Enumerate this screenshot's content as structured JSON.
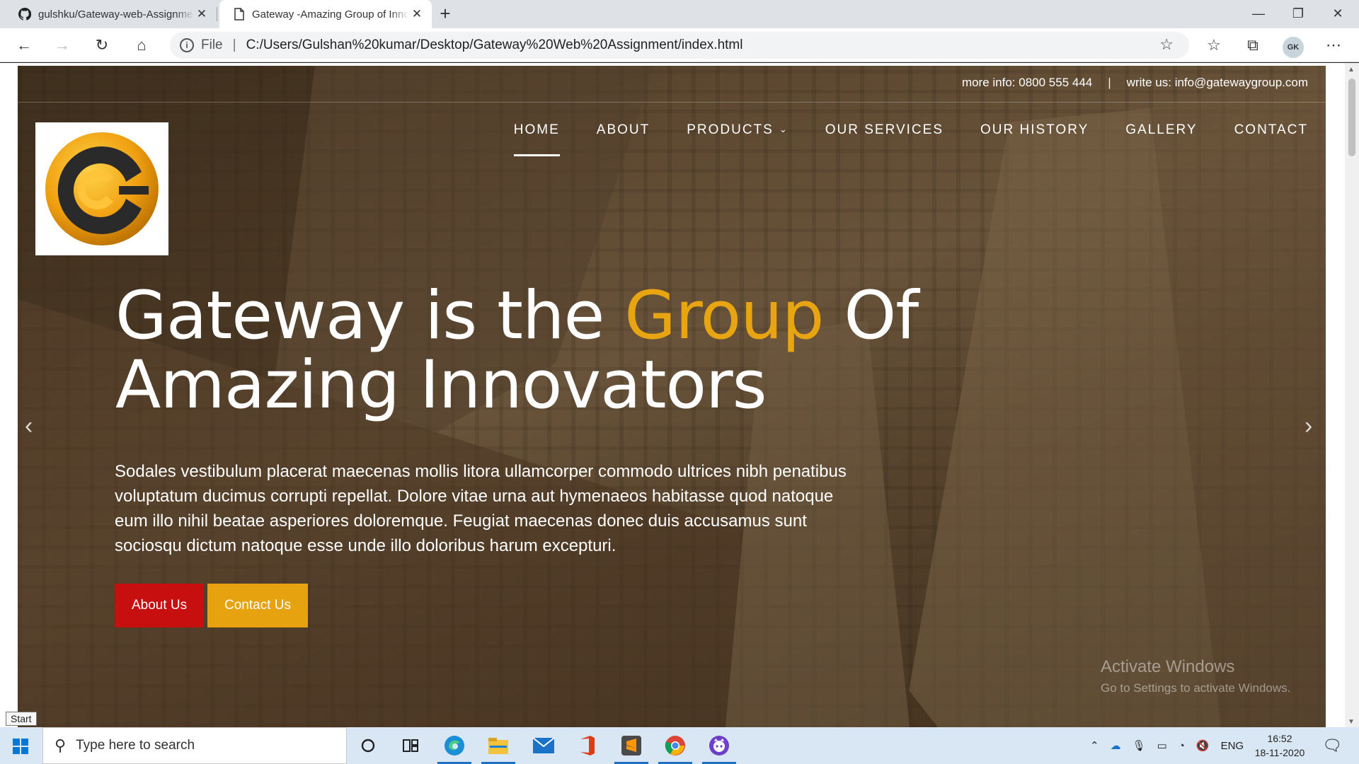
{
  "browser": {
    "tabs": [
      {
        "title": "gulshku/Gateway-web-Assignment",
        "icon": "github-icon"
      },
      {
        "title": "Gateway -Amazing Group of Innovators",
        "icon": "page-icon"
      }
    ],
    "address": {
      "scheme_label": "File",
      "url": "C:/Users/Gulshan%20kumar/Desktop/Gateway%20Web%20Assignment/index.html"
    },
    "profile_initials": "GK"
  },
  "site": {
    "topbar": {
      "phone": "more info: 0800 555 444",
      "divider": "|",
      "email": "write us: info@gatewaygroup.com"
    },
    "nav": [
      {
        "label": "HOME",
        "active": true
      },
      {
        "label": "ABOUT"
      },
      {
        "label": "PRODUCTS",
        "dropdown": true
      },
      {
        "label": "OUR SERVICES"
      },
      {
        "label": "OUR HISTORY"
      },
      {
        "label": "GALLERY"
      },
      {
        "label": "CONTACT"
      }
    ],
    "headline": {
      "part1": "Gateway is the ",
      "accent": "Group",
      "part2": " Of Amazing Innovators"
    },
    "lede": "Sodales vestibulum placerat maecenas mollis litora ullamcorper commodo ultrices nibh penatibus voluptatum ducimus corrupti repellat. Dolore vitae urna aut hymenaeos habitasse quod natoque eum illo nihil beatae asperiores doloremque. Feugiat maecenas donec duis accusamus sunt sociosqu dictum natoque esse unde illo doloribus harum excepturi.",
    "buttons": {
      "about": "About Us",
      "contact": "Contact Us"
    },
    "colors": {
      "accent": "#e9a411",
      "about_button": "#c80f0f",
      "contact_button": "#e6a20f"
    }
  },
  "watermark": {
    "title": "Activate Windows",
    "subtitle": "Go to Settings to activate Windows."
  },
  "tooltip": {
    "start": "Start"
  },
  "taskbar": {
    "search_placeholder": "Type here to search",
    "language": "ENG",
    "time": "16:52",
    "date": "18-11-2020"
  }
}
